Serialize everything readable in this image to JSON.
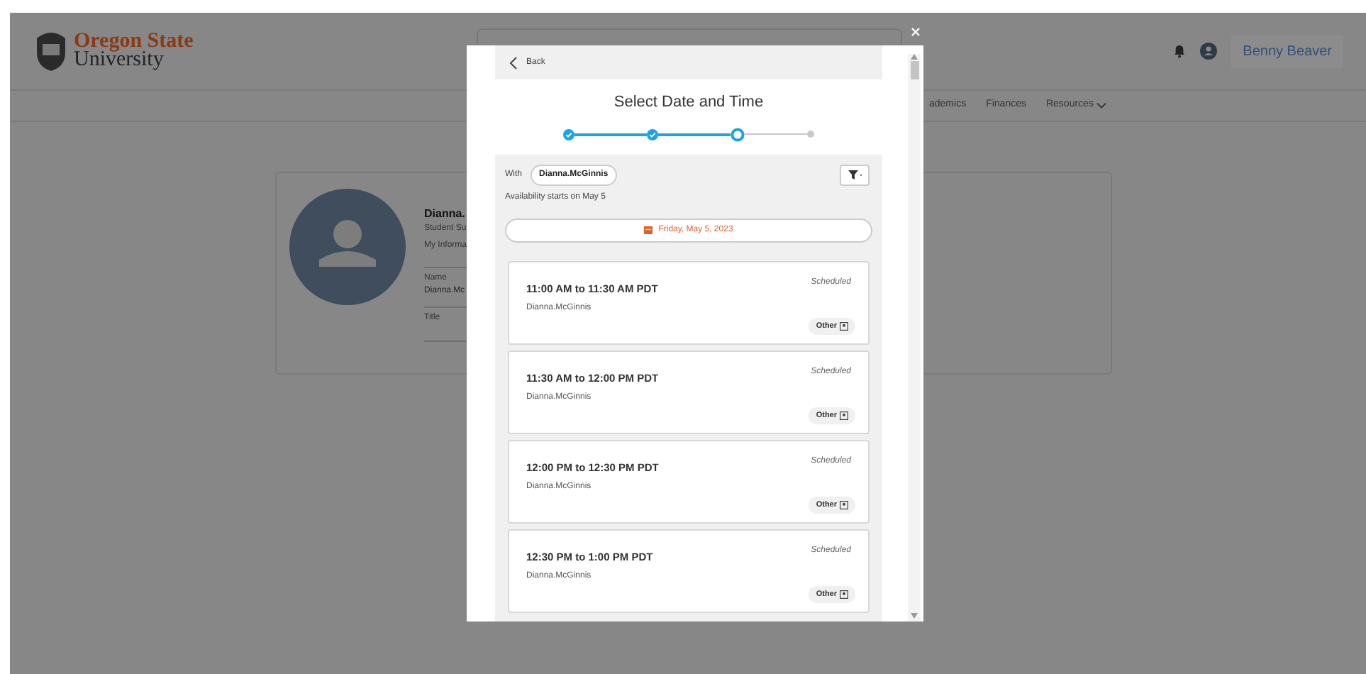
{
  "header": {
    "logo_line1": "Oregon State",
    "logo_line2": "University",
    "user_name": "Benny Beaver"
  },
  "nav": [
    {
      "label": "ademics",
      "has_menu": false
    },
    {
      "label": "Finances",
      "has_menu": false
    },
    {
      "label": "Resources",
      "has_menu": true
    }
  ],
  "profile": {
    "name": "Dianna.",
    "role": "Student Su",
    "section": "My Informa",
    "fields": [
      {
        "label": "Name",
        "value": "Dianna.Mc"
      },
      {
        "label": "Title"
      }
    ]
  },
  "modal": {
    "back": "Back",
    "title": "Select Date and Time",
    "steps": [
      {
        "kind": "done"
      },
      {
        "kind": "done"
      },
      {
        "kind": "current"
      },
      {
        "kind": "pending"
      }
    ],
    "with_label": "With",
    "with_chip": "Dianna.McGinnis",
    "availability": "Availability starts on May 5",
    "date": "Friday, May 5, 2023",
    "slots": [
      {
        "time": "11:00 AM to 11:30 AM PDT",
        "person": "Dianna.McGinnis",
        "status": "Scheduled",
        "tag": "Other"
      },
      {
        "time": "11:30 AM to 12:00 PM PDT",
        "person": "Dianna.McGinnis",
        "status": "Scheduled",
        "tag": "Other"
      },
      {
        "time": "12:00 PM to 12:30 PM PDT",
        "person": "Dianna.McGinnis",
        "status": "Scheduled",
        "tag": "Other"
      },
      {
        "time": "12:30 PM to 1:00 PM PDT",
        "person": "Dianna.McGinnis",
        "status": "Scheduled",
        "tag": "Other"
      }
    ]
  }
}
